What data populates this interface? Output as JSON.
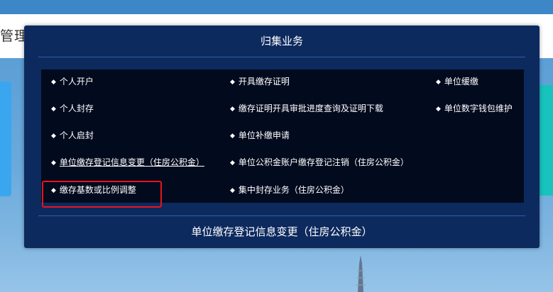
{
  "header": {
    "title": "管理中心"
  },
  "modal": {
    "title": "归集业务",
    "footer": "单位缴存登记信息变更（住房公积金）",
    "columns": [
      [
        "个人开户",
        "个人封存",
        "个人启封",
        "单位缴存登记信息变更（住房公积金）",
        "缴存基数或比例调整"
      ],
      [
        "开具缴存证明",
        "缴存证明开具审批进度查询及证明下载",
        "单位补缴申请",
        "单位公积金账户缴存登记注销（住房公积金）",
        "集中封存业务（住房公积金）"
      ],
      [
        "单位缓缴",
        "单位数字钱包维护"
      ]
    ],
    "bullet": "◆",
    "highlight_color": "#e8141c"
  }
}
